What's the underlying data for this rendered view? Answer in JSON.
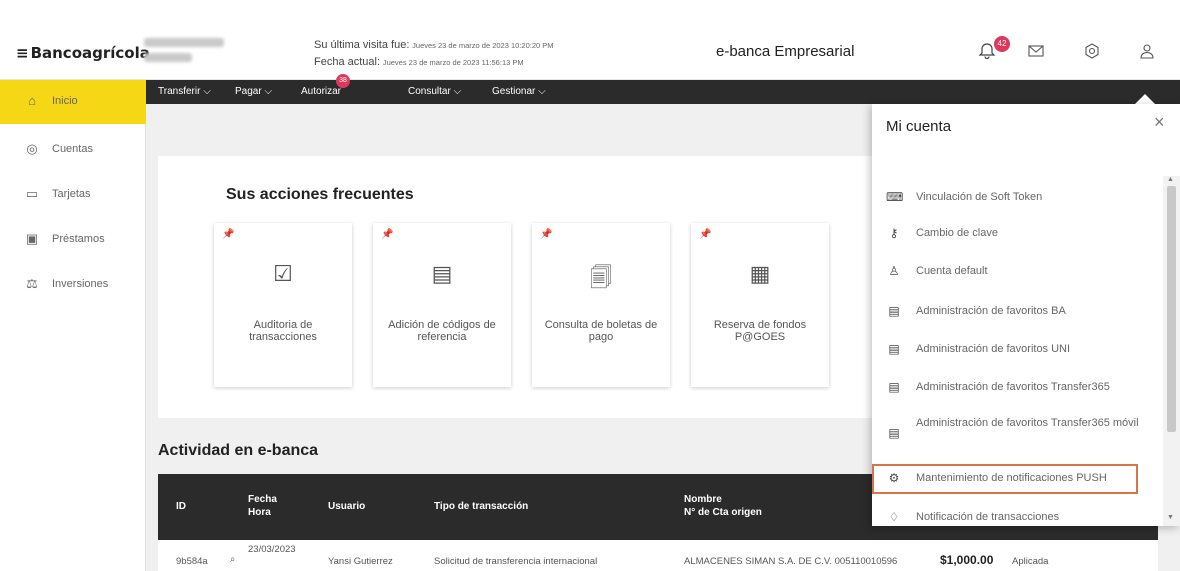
{
  "header": {
    "logo_mark": "≡",
    "logo_text": "Bancoagrícola",
    "last_visit_label": "Su última visita fue:",
    "last_visit_value": "Jueves 23 de marzo de 2023 10:20:20 PM",
    "current_date_label": "Fecha actual:",
    "current_date_value": "Jueves 23 de marzo de 2023 11:56:13 PM",
    "title": "e-banca Empresarial",
    "notification_count": "42",
    "icons": [
      "bell-icon",
      "mail-icon",
      "settings-icon",
      "user-icon"
    ]
  },
  "nav": {
    "items": [
      {
        "label": "Transferir ⌵"
      },
      {
        "label": "Pagar ⌵"
      },
      {
        "label": "Autorizar",
        "badge": "38"
      },
      {
        "label": "Consultar ⌵"
      },
      {
        "label": "Gestionar ⌵"
      }
    ]
  },
  "sidebar": {
    "items": [
      {
        "label": "Inicio",
        "icon": "home-icon",
        "glyph": "⌂"
      },
      {
        "label": "Cuentas",
        "icon": "accounts-icon",
        "glyph": "◎"
      },
      {
        "label": "Tarjetas",
        "icon": "cards-icon",
        "glyph": "▭"
      },
      {
        "label": "Préstamos",
        "icon": "loans-icon",
        "glyph": "▣"
      },
      {
        "label": "Inversiones",
        "icon": "investments-icon",
        "glyph": "⚖"
      }
    ]
  },
  "main": {
    "freq_title": "Sus acciones frecuentes",
    "cards": [
      {
        "label": "Auditoria de transacciones",
        "glyph": "☑"
      },
      {
        "label": "Adición de códigos de referencia",
        "glyph": "▤"
      },
      {
        "label": "Consulta de boletas de pago",
        "glyph": "🗐"
      },
      {
        "label": "Reserva de fondos P@GOES",
        "glyph": "▦"
      }
    ],
    "activity_title": "Actividad en e-banca",
    "table": {
      "headers": {
        "id": "ID",
        "fecha": "Fecha",
        "hora": "Hora",
        "usuario": "Usuario",
        "tipo": "Tipo de transacción",
        "nombre": "Nombre",
        "cta": "N° de Cta origen"
      },
      "row": {
        "id": "9b584a",
        "fecha": "23/03/2023",
        "usuario": "Yansi Gutierrez",
        "tipo": "Solicitud de transferencia internacional",
        "nombre": "ALMACENES SIMAN S.A. DE C.V. 005110010596",
        "monto": "$1,000.00",
        "estado": "Aplicada"
      }
    }
  },
  "panel": {
    "title": "Mi cuenta",
    "close": "×",
    "items": [
      {
        "label": "Vinculación de Soft Token",
        "icon": "soft-token-icon",
        "glyph": "⌨"
      },
      {
        "label": "Cambio de clave",
        "icon": "key-icon",
        "glyph": "⚷"
      },
      {
        "label": "Cuenta default",
        "icon": "account-default-icon",
        "glyph": "♙"
      },
      {
        "label": "Administración de favoritos BA",
        "icon": "favorites-icon",
        "glyph": "▤"
      },
      {
        "label": "Administración de favoritos UNI",
        "icon": "favorites-icon",
        "glyph": "▤"
      },
      {
        "label": "Administración de favoritos Transfer365",
        "icon": "favorites-icon",
        "glyph": "▤"
      },
      {
        "label": "Administración de favoritos Transfer365 móvil",
        "icon": "favorites-icon",
        "glyph": "▤"
      },
      {
        "label": "Mantenimiento de notificaciones PUSH",
        "icon": "notification-settings-icon",
        "glyph": "⚙"
      },
      {
        "label": "Notificación de transacciones",
        "icon": "notification-icon",
        "glyph": "♢"
      }
    ]
  }
}
